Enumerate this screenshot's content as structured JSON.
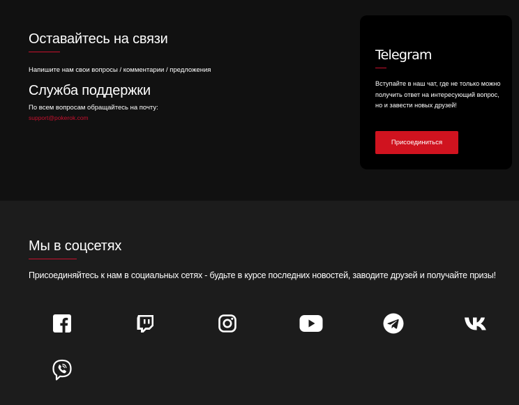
{
  "contact": {
    "title": "Оставайтесь на связи",
    "subtitle": "Напишите нам свои вопросы / комментарии / предложения",
    "support_title": "Служба поддержки",
    "support_text": "По всем вопросам обращайтесь на почту:",
    "support_email": "support@pokerok.com"
  },
  "telegram_card": {
    "title": "Telegram",
    "text": "Вступайте в наш чат, где не только можно получить ответ на интересующий вопрос, но и завести новых друзей!",
    "button_label": "Присоединиться"
  },
  "social": {
    "title": "Мы в соцсетях",
    "lead": "Присоединяйтесь к нам в социальных сетях - будьте в курсе последних новостей, заводите друзей и получайте призы!",
    "icons": [
      "facebook-icon",
      "twitch-icon",
      "instagram-icon",
      "youtube-icon",
      "telegram-icon",
      "vk-icon",
      "viber-icon"
    ]
  },
  "colors": {
    "accent": "#c8102e",
    "button": "#d0131f",
    "top_bg": "#111111",
    "bottom_bg": "#1c1c1c",
    "card_bg": "#000000"
  }
}
